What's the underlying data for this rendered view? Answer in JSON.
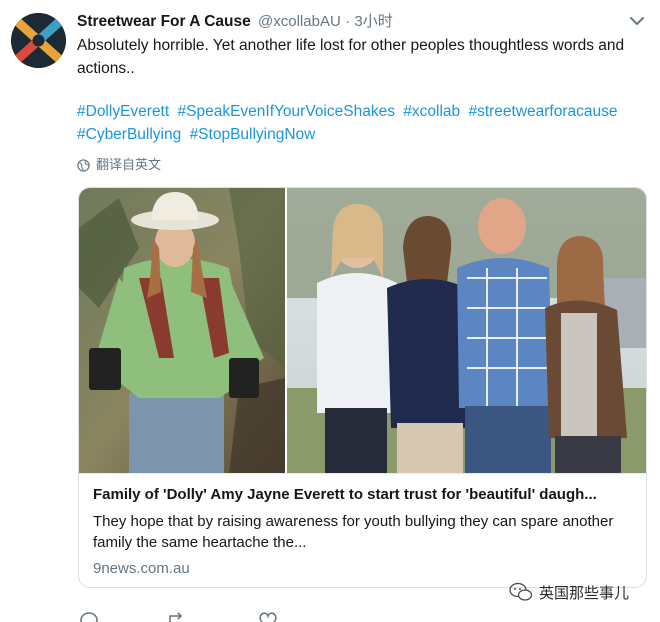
{
  "tweet": {
    "author_name": "Streetwear For A Cause",
    "author_handle": "@xcollabAU",
    "separator": "·",
    "time": "3小时",
    "text": "Absolutely horrible. Yet another life lost for other peoples thoughtless words and actions..",
    "hashtags": [
      "#DollyEverett",
      "#SpeakEvenIfYourVoiceShakes",
      "#xcollab",
      "#streetwearforacause",
      "#CyberBullying",
      "#StopBullyingNow"
    ],
    "translate_label": "翻译自英文"
  },
  "card": {
    "title": "Family of 'Dolly' Amy Jayne Everett to start trust for 'beautiful' daugh...",
    "description": "They hope that by raising awareness for youth bullying they can spare another family the same heartache the...",
    "domain": "9news.com.au"
  },
  "watermark": {
    "text": "英国那些事儿"
  },
  "icons": {
    "avatar": "xcollab-logo",
    "caret": "chevron-down-icon",
    "globe": "globe-icon",
    "reply": "reply-icon",
    "retweet": "retweet-icon",
    "like": "heart-icon"
  },
  "colors": {
    "link": "#1b95e0",
    "secondary": "#657786",
    "border": "#d9dfe3"
  }
}
